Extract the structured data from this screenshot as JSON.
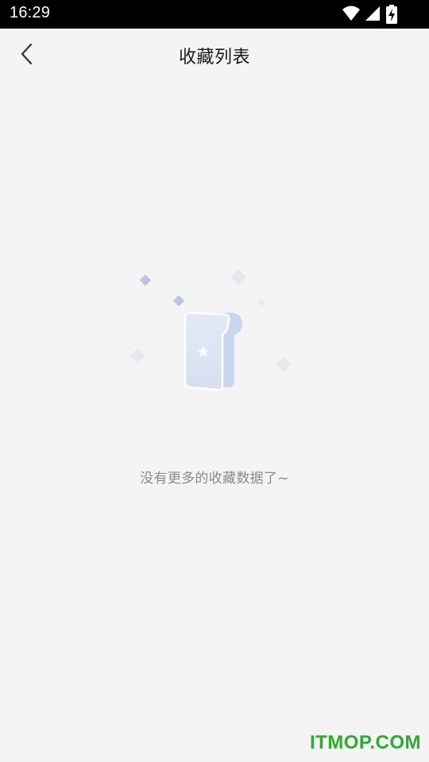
{
  "status_bar": {
    "time": "16:29",
    "icons": [
      "wifi-icon",
      "cellular-signal-icon",
      "battery-charging-icon"
    ]
  },
  "header": {
    "back_icon": "chevron-left-icon",
    "title": "收藏列表"
  },
  "empty_state": {
    "illustration": "empty-collection-illustration",
    "message": "没有更多的收藏数据了~"
  },
  "watermark": {
    "text": "ITMOP.COM",
    "color": "#2eaa2e"
  },
  "colors": {
    "background": "#f4f4f4",
    "status_bar": "#000000",
    "title_text": "#1a1a1a",
    "muted_text": "#8a8a8a",
    "illustration_blue": "#c9d6ef"
  }
}
